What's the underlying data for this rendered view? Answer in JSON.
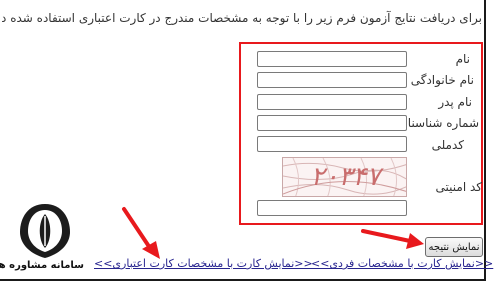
{
  "intro_text": "برای دریافت نتایج آزمون فرم زیر را با توجه به مشخصات مندرج در کارت اعتباری استفاده شده در زمان ثبت نام",
  "form": {
    "first_name_label": "نام",
    "last_name_label": "نام خانوادگی",
    "father_name_label": "نام پدر",
    "id_number_label": "شماره شناسنامه",
    "national_code_label": "کدملی",
    "security_code_label": "کد امنیتی",
    "captcha_text": "۲۰۳۴۷"
  },
  "buttons": {
    "submit_label": "نمایش نتیجه"
  },
  "links": {
    "personal_info": "<<نمایش کارت با مشخصات فردی>>",
    "credit_card": "<<نمایش کارت با مشخصات کارت اعتباری>>"
  },
  "logo": {
    "text": "سامانه مشاوره هپوا"
  },
  "colors": {
    "form_border": "#e8191d",
    "arrow": "#e8191d",
    "link": "#27248f"
  }
}
